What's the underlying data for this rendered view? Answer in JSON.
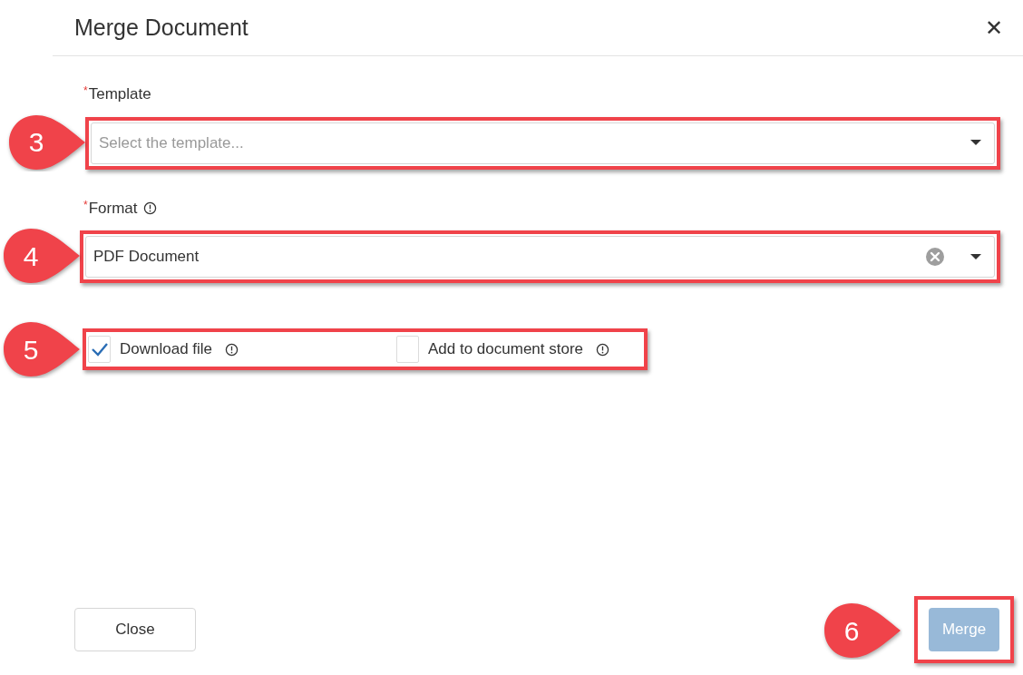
{
  "dialog": {
    "title": "Merge Document",
    "close_icon": "✕"
  },
  "fields": [
    {
      "label": "Template",
      "required_mark": "*",
      "placeholder": "Select the template...",
      "clearable": false,
      "callout": "3"
    },
    {
      "label": "Format",
      "required_mark": "*",
      "info": true,
      "value": "PDF Document",
      "clearable": true,
      "callout": "4"
    }
  ],
  "options": {
    "callout": "5",
    "items": [
      {
        "label": "Download file",
        "checked": true
      },
      {
        "label": "Add to document store",
        "checked": false
      }
    ]
  },
  "buttons": [
    {
      "label": "Close",
      "kind": "secondary",
      "disabled": false
    },
    {
      "label": "Merge",
      "kind": "primary",
      "disabled": true,
      "callout": "6"
    }
  ]
}
